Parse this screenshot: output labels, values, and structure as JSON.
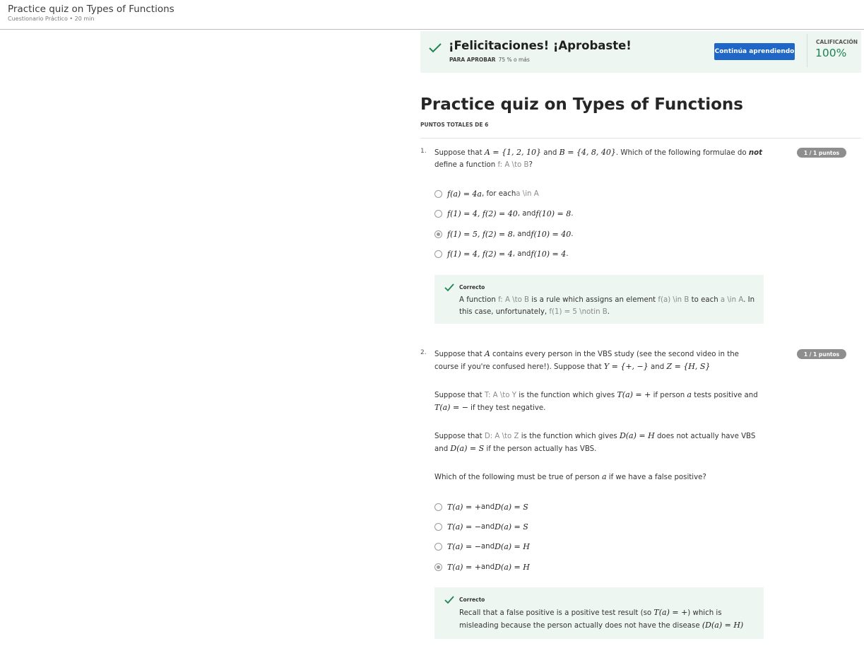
{
  "header": {
    "title": "Practice quiz on Types of Functions",
    "subtitle": "Cuestionario Práctico • 20 min"
  },
  "banner": {
    "title": "¡Felicitaciones! ¡Aprobaste!",
    "pass_label": "PARA APROBAR",
    "pass_value": "75 % o más",
    "continue_button": "Continúa aprendiendo",
    "grade_label": "CALIFICACIÓN",
    "grade_value": "100%",
    "accent_color": "#1f8354",
    "button_color": "#1f66c6"
  },
  "quiz": {
    "title": "Practice quiz on Types of Functions",
    "total_points": "PUNTOS TOTALES DE 6"
  },
  "q1": {
    "number": "1.",
    "badge": "1 / 1 puntos",
    "text": {
      "a": "Suppose that ",
      "m1": "A = {1, 2, 10}",
      "b": " and ",
      "m2": "B = {4, 8, 40}",
      "c": ". Which of the following formulae do ",
      "em": "not",
      "d": " define a function ",
      "t1": "f: A \\to B",
      "e": "?"
    },
    "options": [
      {
        "m": "f(a) = 4a",
        "rest": ", for each ",
        "tex": "a \\in A",
        "selected": false
      },
      {
        "m": "f(1) = 4, f(2) = 40",
        "rest": ", and ",
        "m2": "f(10) = 8",
        "end": ".",
        "selected": false
      },
      {
        "m": "f(1) = 5, f(2) = 8",
        "rest": ", and ",
        "m2": "f(10) = 40",
        "end": ".",
        "selected": true
      },
      {
        "m": "f(1) = 4, f(2) = 4",
        "rest": ", and ",
        "m2": "f(10) = 4",
        "end": ".",
        "selected": false
      }
    ],
    "feedback": {
      "label": "Correcto",
      "a": "A function ",
      "t1": "f: A \\to B",
      "b": " is a rule which assigns an element ",
      "t2": "f(a) \\in B",
      "c": " to each ",
      "t3": "a \\in A",
      "d": ". In this case, unfortunately, ",
      "t4": "f(1) = 5 \\notin B",
      "e": "."
    }
  },
  "q2": {
    "number": "2.",
    "badge": "1 / 1 puntos",
    "p1": {
      "a": "Suppose that ",
      "m1": "A",
      "b": " contains every person in the VBS study (see the second video in the course if you're confused here!). Suppose that ",
      "m2": "Y = {+, −}",
      "c": " and ",
      "m3": "Z = {H, S}"
    },
    "p2": {
      "a": "Suppose that ",
      "t1": "T: A \\to Y",
      "b": " is the function which gives ",
      "m1": "T(a) = +",
      "c": " if person ",
      "m2": "a",
      "d": " tests positive and ",
      "m3": "T(a) = −",
      "e": " if they test negative."
    },
    "p3": {
      "a": "Suppose that ",
      "t1": "D: A \\to Z",
      "b": " is the function which gives ",
      "m1": "D(a) = H",
      "c": " does not actually have VBS and ",
      "m2": "D(a) = S",
      "d": " if the person actually has VBS."
    },
    "p4": {
      "a": "Which of the following must be true of person ",
      "m1": "a",
      "b": " if we have a false positive?"
    },
    "options": [
      {
        "m": "T(a) = +",
        "rest": " and ",
        "m2": "D(a) = S",
        "selected": false
      },
      {
        "m": "T(a) = −",
        "rest": " and ",
        "m2": "D(a) = S",
        "selected": false
      },
      {
        "m": "T(a) = −",
        "rest": " and ",
        "m2": "D(a) = H",
        "selected": false
      },
      {
        "m": "T(a) = +",
        "rest": " and ",
        "m2": "D(a) = H",
        "selected": true
      }
    ],
    "feedback": {
      "label": "Correcto",
      "a": "Recall that a false positive is a positive test result (so ",
      "m1": "T(a) = +",
      "b": ") which is misleading because the person actually does not have the disease ",
      "m2": "(D(a) = H)"
    }
  }
}
